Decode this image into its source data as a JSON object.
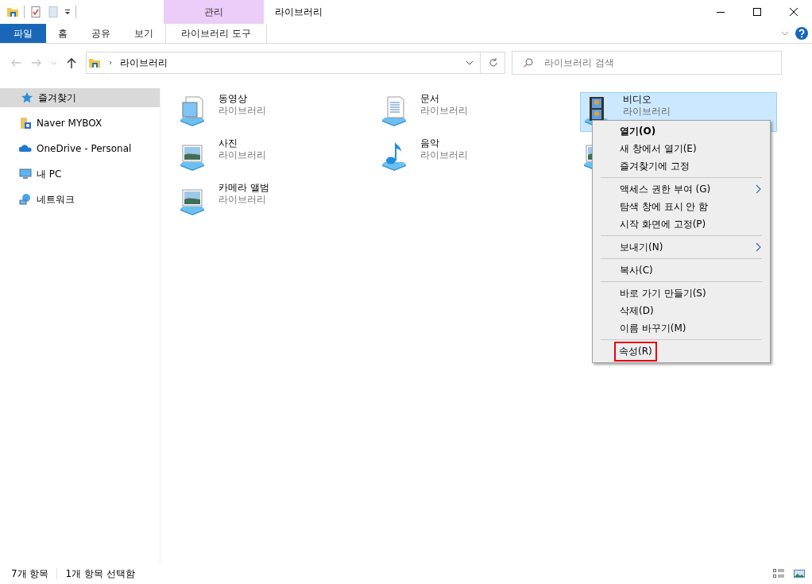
{
  "window": {
    "title": "라이브러리",
    "context_tab_group": "관리"
  },
  "ribbon": {
    "tabs": [
      {
        "label": "파일",
        "selected": true,
        "kind": "file"
      },
      {
        "label": "홈",
        "selected": false,
        "kind": "tab"
      },
      {
        "label": "공유",
        "selected": false,
        "kind": "tab"
      },
      {
        "label": "보기",
        "selected": false,
        "kind": "tab"
      },
      {
        "label": "라이브러리 도구",
        "selected": false,
        "kind": "context"
      }
    ]
  },
  "address_bar": {
    "path": [
      {
        "label": "라이브러리"
      }
    ]
  },
  "search": {
    "placeholder": "라이브러리 검색"
  },
  "sidebar": {
    "items": [
      {
        "label": "즐겨찾기",
        "kind": "star",
        "selected": true
      },
      {
        "label": "Naver MYBOX",
        "kind": "mybox",
        "selected": false
      },
      {
        "label": "OneDrive - Personal",
        "kind": "cloud",
        "selected": false
      },
      {
        "label": "내 PC",
        "kind": "pc",
        "selected": false
      },
      {
        "label": "네트워크",
        "kind": "network",
        "selected": false
      }
    ]
  },
  "libraries": [
    {
      "name": "동영상",
      "type": "라이브러리",
      "kind": "doc",
      "selected": false
    },
    {
      "name": "문서",
      "type": "라이브러리",
      "kind": "text",
      "selected": false
    },
    {
      "name": "비디오",
      "type": "라이브러리",
      "kind": "film",
      "selected": true
    },
    {
      "name": "사진",
      "type": "라이브러리",
      "kind": "photo",
      "selected": false
    },
    {
      "name": "음악",
      "type": "라이브러리",
      "kind": "music",
      "selected": false
    },
    {
      "kind": "photo",
      "selected": false
    },
    {
      "name": "카메라 앨범",
      "type": "라이브러리",
      "kind": "photo",
      "selected": false
    }
  ],
  "context_menu": {
    "items": [
      {
        "kind": "item",
        "label": "열기(O)",
        "default": true
      },
      {
        "kind": "item",
        "label": "새 창에서 열기(E)"
      },
      {
        "kind": "item",
        "label": "즐겨찾기에 고정"
      },
      {
        "kind": "separator"
      },
      {
        "kind": "item",
        "label": "액세스 권한 부여 (G)",
        "submenu": true
      },
      {
        "kind": "item",
        "label": "탐색 창에 표시 안 함"
      },
      {
        "kind": "item",
        "label": "시작 화면에 고정(P)"
      },
      {
        "kind": "separator"
      },
      {
        "kind": "item",
        "label": "보내기(N)",
        "submenu": true
      },
      {
        "kind": "separator"
      },
      {
        "kind": "item",
        "label": "복사(C)"
      },
      {
        "kind": "separator"
      },
      {
        "kind": "item",
        "label": "바로 가기 만들기(S)"
      },
      {
        "kind": "item",
        "label": "삭제(D)"
      },
      {
        "kind": "item",
        "label": "이름 바꾸기(M)"
      },
      {
        "kind": "separator"
      },
      {
        "kind": "item",
        "label": "속성(R)",
        "highlighted": true
      }
    ]
  },
  "status_bar": {
    "item_count": "7개 항목",
    "selection": "1개 항목 선택함"
  }
}
